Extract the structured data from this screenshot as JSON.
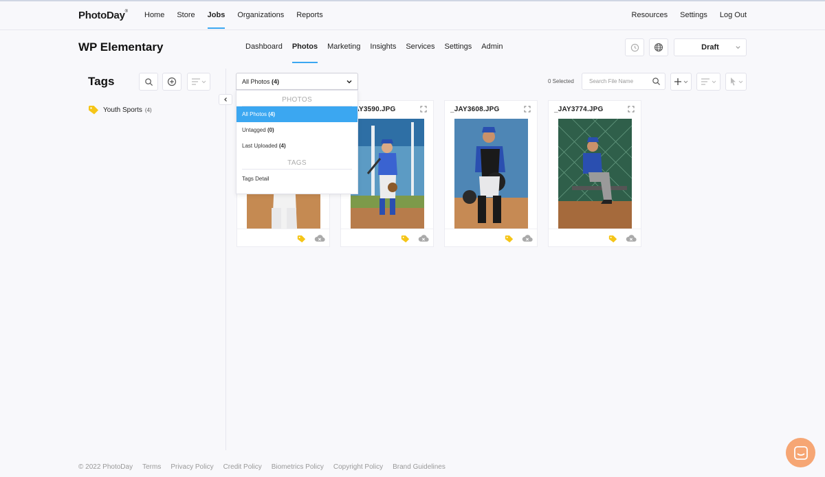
{
  "brand": {
    "logo": "PhotoDay",
    "trademark": "®"
  },
  "topnav": {
    "left": [
      "Home",
      "Store",
      "Jobs",
      "Organizations",
      "Reports"
    ],
    "active": "Jobs",
    "right": [
      "Resources",
      "Settings",
      "Log Out"
    ]
  },
  "job": {
    "title": "WP Elementary",
    "tabs": [
      "Dashboard",
      "Photos",
      "Marketing",
      "Insights",
      "Services",
      "Settings",
      "Admin"
    ],
    "active_tab": "Photos",
    "status": "Draft"
  },
  "sidebar": {
    "title": "Tags",
    "tags": [
      {
        "label": "Youth Sports",
        "count": "(4)"
      }
    ]
  },
  "toolbar": {
    "filter_value": "All Photos",
    "filter_count": "(4)",
    "selected_text": "0 Selected",
    "search_placeholder": "Search File Name"
  },
  "dropdown": {
    "photos_header": "PHOTOS",
    "items": [
      {
        "label": "All Photos",
        "count": "(4)"
      },
      {
        "label": "Untagged",
        "count": "(0)"
      },
      {
        "label": "Last Uploaded",
        "count": "(4)"
      }
    ],
    "tags_header": "TAGS",
    "tags_items": [
      "Tags Detail"
    ]
  },
  "photos": [
    {
      "filename": ""
    },
    {
      "filename": "_JAY3590.JPG"
    },
    {
      "filename": "_JAY3608.JPG"
    },
    {
      "filename": "_JAY3774.JPG"
    }
  ],
  "footer": {
    "links": [
      "© 2022 PhotoDay",
      "Terms",
      "Privacy Policy",
      "Credit Policy",
      "Biometrics Policy",
      "Copyright Policy",
      "Brand Guidelines"
    ]
  },
  "colors": {
    "accent": "#3ba7f1",
    "tag": "#f5c518",
    "chat": "#f6a674"
  }
}
